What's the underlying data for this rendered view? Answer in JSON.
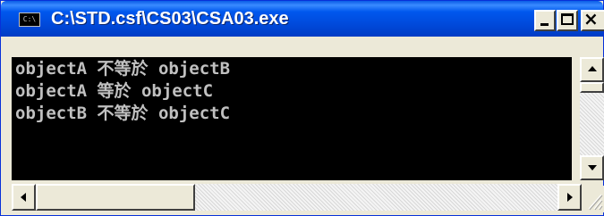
{
  "window": {
    "title": "C:\\STD.csf\\CS03\\CSA03.exe",
    "icon_label": "C:\\",
    "buttons": {
      "minimize": "minimize-icon",
      "maximize": "maximize-icon",
      "close": "close-icon"
    }
  },
  "console": {
    "background": "#000000",
    "text_color": "#c0c0c0",
    "lines": [
      "objectA 不等於 objectB",
      "objectA 等於 objectC",
      "objectB 不等於 objectC"
    ]
  },
  "colors": {
    "titlebar": "#0058ee",
    "chrome": "#ece9d8"
  }
}
